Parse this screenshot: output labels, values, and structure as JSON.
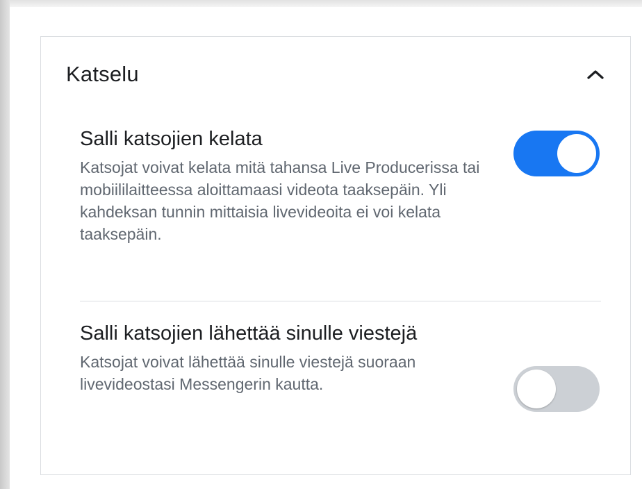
{
  "section": {
    "title": "Katselu",
    "chevron_icon": "chevron-up-icon",
    "expanded": true
  },
  "settings": [
    {
      "title": "Salli katsojien kelata",
      "description": "Katsojat voivat kelata mitä tahansa Live Producerissa tai mobiililaitteessa aloittamaasi videota taaksepäin. Yli kahdeksan tunnin mittaisia livevideoita ei voi kelata taaksepäin.",
      "enabled": true
    },
    {
      "title": "Salli katsojien lähettää sinulle viestejä",
      "description": "Katsojat voivat lähettää sinulle viestejä suoraan livevideostasi Messengerin kautta.",
      "enabled": false
    }
  ],
  "colors": {
    "toggle_on": "#1877f2",
    "toggle_off": "#ccd0d5",
    "title_text": "#1c1e21",
    "description_text": "#606770"
  }
}
